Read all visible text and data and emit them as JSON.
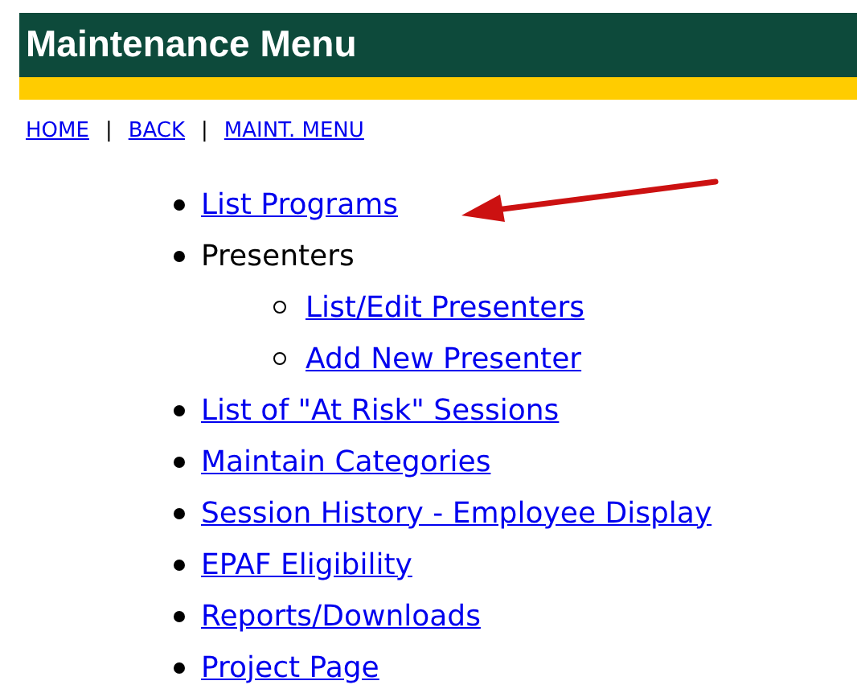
{
  "header": {
    "title": "Maintenance Menu"
  },
  "nav_links": [
    "HOME",
    "BACK",
    "MAINT. MENU"
  ],
  "nav_separator": "|",
  "menu": [
    {
      "label": "List Programs",
      "kind": "link"
    },
    {
      "label": "Presenters",
      "kind": "text",
      "children": [
        {
          "label": "List/Edit Presenters",
          "kind": "link"
        },
        {
          "label": "Add New Presenter",
          "kind": "link"
        }
      ]
    },
    {
      "label": "List of \"At Risk\" Sessions",
      "kind": "link"
    },
    {
      "label": "Maintain Categories",
      "kind": "link"
    },
    {
      "label": "Session History - Employee Display",
      "kind": "link"
    },
    {
      "label": "EPAF Eligibility",
      "kind": "link"
    },
    {
      "label": "Reports/Downloads",
      "kind": "link"
    },
    {
      "label": "Project Page",
      "kind": "link"
    }
  ]
}
